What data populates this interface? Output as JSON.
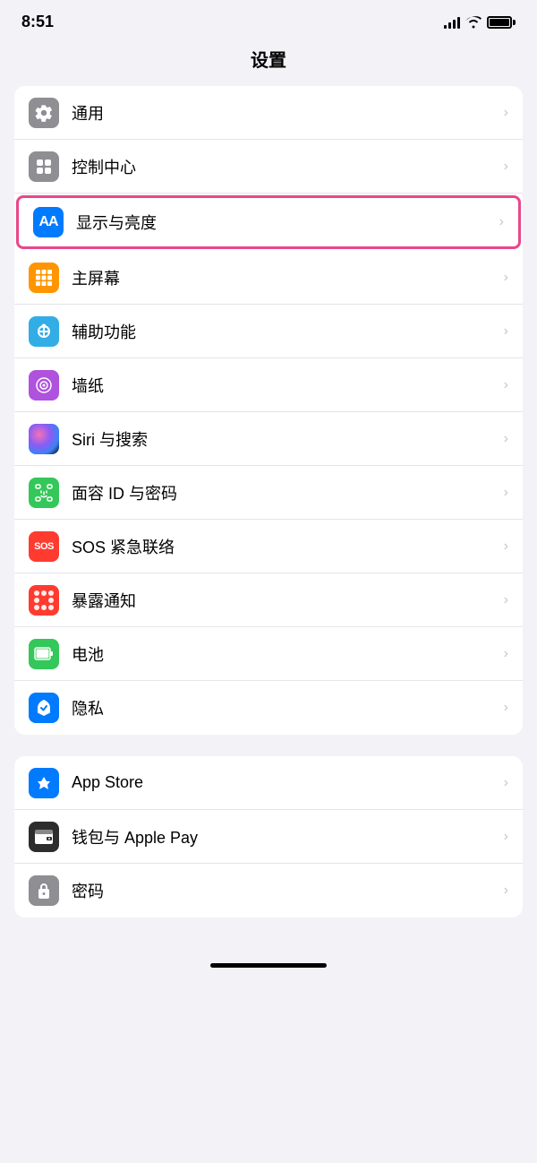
{
  "statusBar": {
    "time": "8:51",
    "signal": "full",
    "wifi": true,
    "battery": "full"
  },
  "pageTitle": "设置",
  "sections": [
    {
      "id": "section1",
      "items": [
        {
          "id": "general",
          "label": "通用",
          "iconType": "gear",
          "iconBg": "gray",
          "highlighted": false
        },
        {
          "id": "control-center",
          "label": "控制中心",
          "iconType": "toggle",
          "iconBg": "gray",
          "highlighted": false
        },
        {
          "id": "display",
          "label": "显示与亮度",
          "iconType": "aa",
          "iconBg": "blue",
          "highlighted": true
        },
        {
          "id": "homescreen",
          "label": "主屏幕",
          "iconType": "grid",
          "iconBg": "grid",
          "highlighted": false
        },
        {
          "id": "accessibility",
          "label": "辅助功能",
          "iconType": "accessibility",
          "iconBg": "teal",
          "highlighted": false
        },
        {
          "id": "wallpaper",
          "label": "墙纸",
          "iconType": "wallpaper",
          "iconBg": "purple",
          "highlighted": false
        },
        {
          "id": "siri",
          "label": "Siri 与搜索",
          "iconType": "siri",
          "iconBg": "siri",
          "highlighted": false
        },
        {
          "id": "faceid",
          "label": "面容 ID 与密码",
          "iconType": "faceid",
          "iconBg": "green-faceid",
          "highlighted": false
        },
        {
          "id": "sos",
          "label": "SOS 紧急联络",
          "iconType": "sos",
          "iconBg": "red-sos",
          "highlighted": false
        },
        {
          "id": "exposure",
          "label": "暴露通知",
          "iconType": "exposure",
          "iconBg": "exposure",
          "highlighted": false
        },
        {
          "id": "battery",
          "label": "电池",
          "iconType": "battery",
          "iconBg": "battery",
          "highlighted": false
        },
        {
          "id": "privacy",
          "label": "隐私",
          "iconType": "privacy",
          "iconBg": "privacy",
          "highlighted": false
        }
      ]
    },
    {
      "id": "section2",
      "items": [
        {
          "id": "appstore",
          "label": "App Store",
          "iconType": "appstore",
          "iconBg": "appstore",
          "highlighted": false
        },
        {
          "id": "wallet",
          "label": "钱包与 Apple Pay",
          "iconType": "wallet",
          "iconBg": "wallet",
          "highlighted": false
        },
        {
          "id": "password",
          "label": "密码",
          "iconType": "password",
          "iconBg": "password",
          "highlighted": false
        }
      ]
    }
  ],
  "chevron": "›"
}
